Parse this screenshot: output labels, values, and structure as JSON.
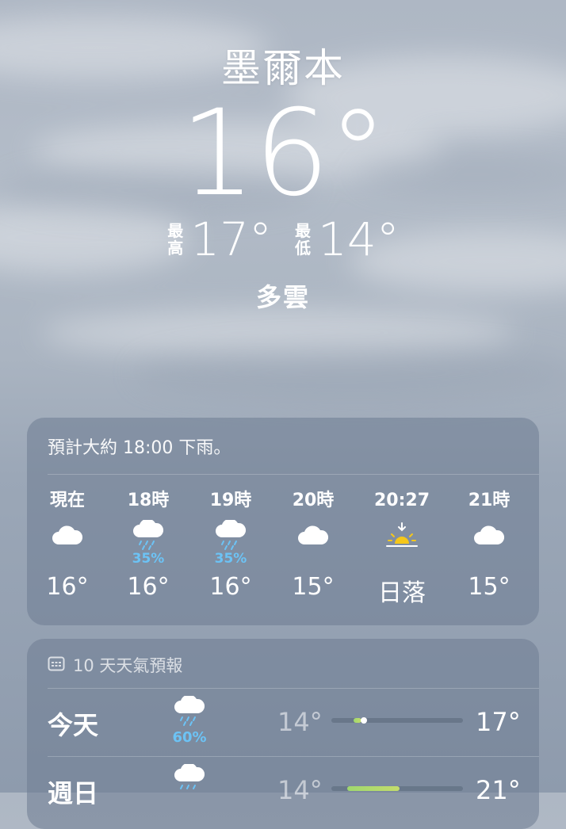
{
  "location": {
    "city": "墨爾本",
    "temperature": "16°",
    "high_label": "最高",
    "high": "17°",
    "low_label": "最低",
    "low": "14°",
    "condition": "多雲"
  },
  "hourly": {
    "summary": "預計大約 18:00 下雨。",
    "items": [
      {
        "time": "現在",
        "icon": "cloud-icon",
        "pop": "",
        "temp": "16°"
      },
      {
        "time": "18時",
        "icon": "cloud-rain-icon",
        "pop": "35%",
        "temp": "16°"
      },
      {
        "time": "19時",
        "icon": "cloud-rain-icon",
        "pop": "35%",
        "temp": "16°"
      },
      {
        "time": "20時",
        "icon": "cloud-icon",
        "pop": "",
        "temp": "15°"
      },
      {
        "time": "20:27",
        "icon": "sunset-icon",
        "pop": "",
        "temp": "日落"
      },
      {
        "time": "21時",
        "icon": "cloud-icon",
        "pop": "",
        "temp": "15°"
      }
    ]
  },
  "daily": {
    "header": "10 天天氣預報",
    "header_icon": "calendar-icon",
    "days": [
      {
        "name": "今天",
        "icon": "cloud-rain-icon",
        "pop": "60%",
        "low": "14°",
        "high": "17°"
      },
      {
        "name": "週日",
        "icon": "cloud-rain-icon",
        "pop": "",
        "low": "14°",
        "high": "21°"
      }
    ]
  },
  "colors": {
    "precip": "#6cc3f5",
    "sun": "#f5c71a",
    "range_start": "#9fd86e",
    "range_end": "#c4dc6c"
  }
}
